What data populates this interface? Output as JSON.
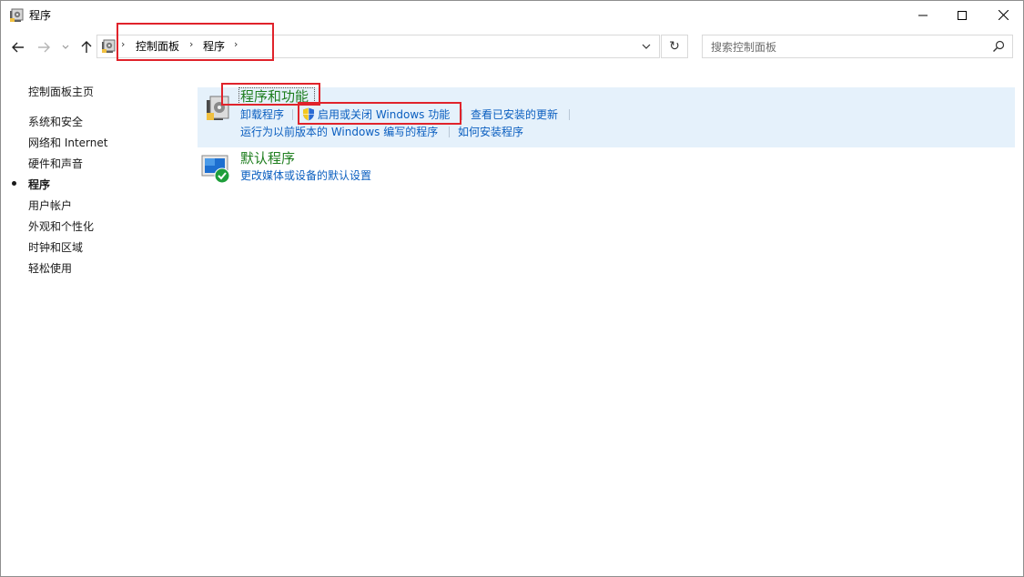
{
  "window": {
    "title": "程序",
    "app_icon": "control-panel-programs-icon"
  },
  "title_buttons": {
    "minimize": "minimize-icon",
    "maximize": "maximize-icon",
    "close": "close-icon"
  },
  "nav": {
    "back": "back-arrow-icon",
    "forward": "forward-arrow-icon",
    "recent": "chevron-down-icon",
    "up": "up-arrow-icon",
    "refresh_glyph": "↻"
  },
  "breadcrumb": {
    "items": [
      "控制面板",
      "程序"
    ],
    "separator": "›"
  },
  "search": {
    "placeholder": "搜索控制面板"
  },
  "sidebar": {
    "home": "控制面板主页",
    "items": [
      {
        "label": "系统和安全",
        "active": false
      },
      {
        "label": "网络和 Internet",
        "active": false
      },
      {
        "label": "硬件和声音",
        "active": false
      },
      {
        "label": "程序",
        "active": true
      },
      {
        "label": "用户帐户",
        "active": false
      },
      {
        "label": "外观和个性化",
        "active": false
      },
      {
        "label": "时钟和区域",
        "active": false
      },
      {
        "label": "轻松使用",
        "active": false
      }
    ]
  },
  "categories": [
    {
      "title": "程序和功能",
      "icon": "programs-features-icon",
      "links": [
        "卸载程序",
        "启用或关闭 Windows 功能",
        "查看已安装的更新",
        "运行为以前版本的 Windows 编写的程序",
        "如何安装程序"
      ]
    },
    {
      "title": "默认程序",
      "icon": "default-programs-icon",
      "links": [
        "更改媒体或设备的默认设置"
      ]
    }
  ],
  "colors": {
    "highlight": "#e5f1fb",
    "link": "#0b5fc0",
    "category_title": "#1e7e1e",
    "annotation": "#e0232b"
  }
}
